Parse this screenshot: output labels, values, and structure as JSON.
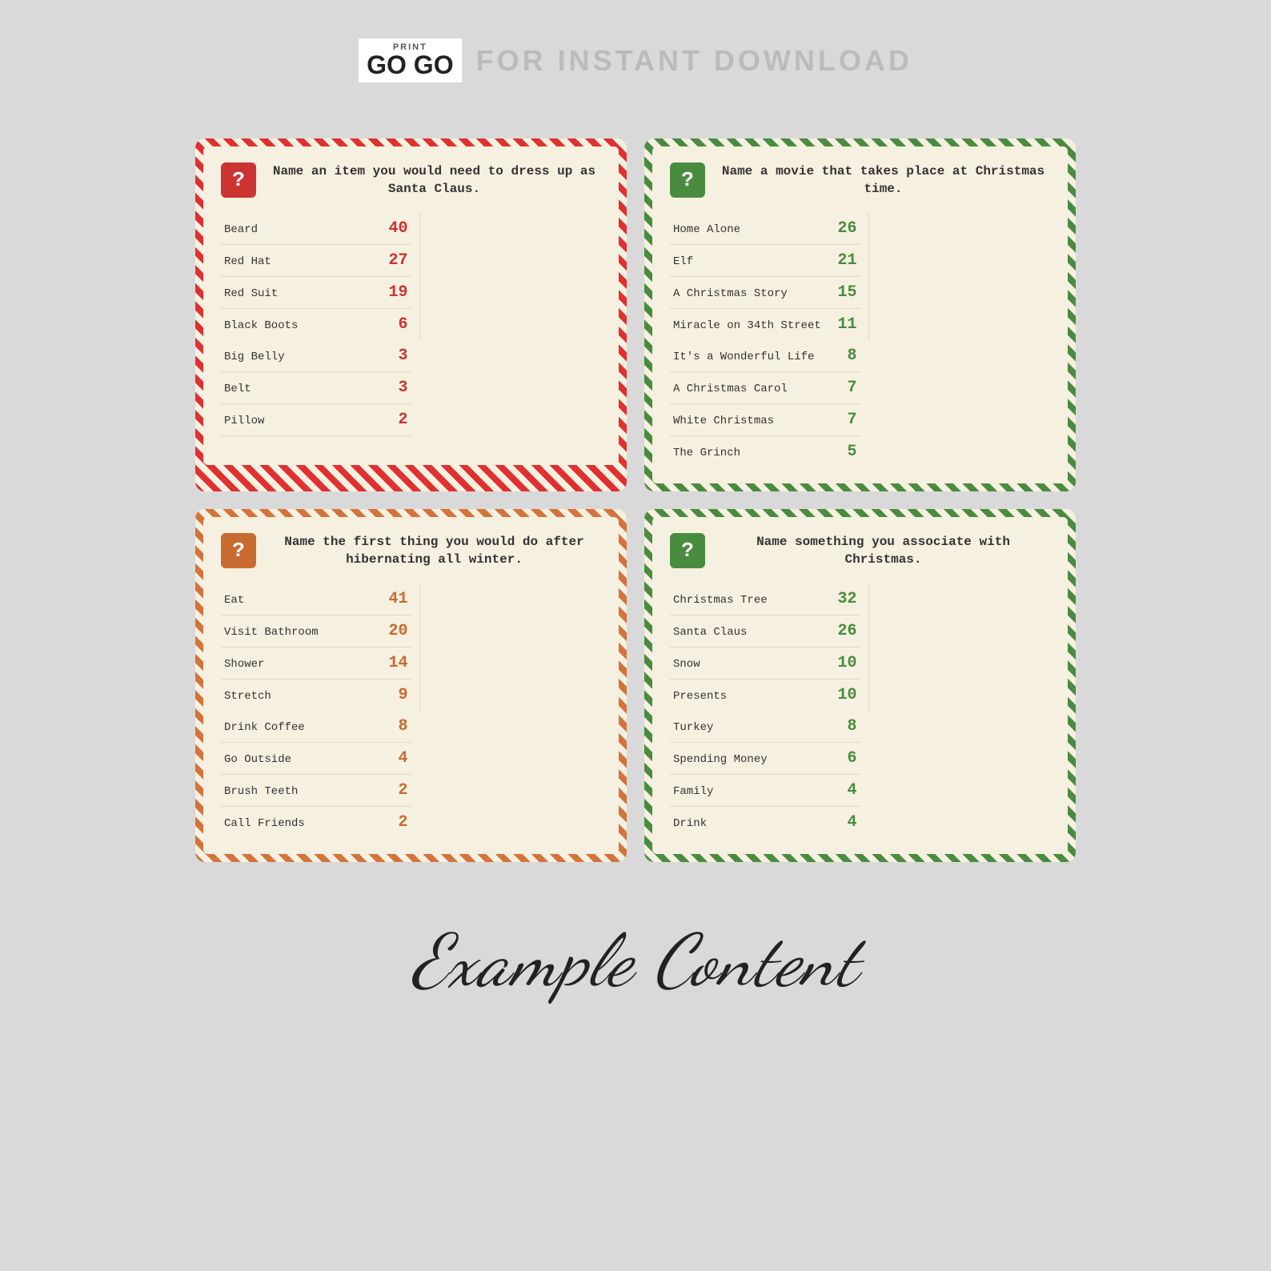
{
  "header": {
    "logo_print": "PRINT",
    "logo_gogo": "GO GO",
    "tagline": "FOR INSTANT DOWNLOAD"
  },
  "cards": [
    {
      "id": "card-santa",
      "border": "red",
      "icon_char": "?",
      "icon_color": "red",
      "title": "Name an item you would need to dress up as Santa Claus.",
      "left_items": [
        {
          "label": "Beard",
          "number": "40"
        },
        {
          "label": "Red Hat",
          "number": "27"
        },
        {
          "label": "Red Suit",
          "number": "19"
        },
        {
          "label": "Black Boots",
          "number": "6"
        }
      ],
      "right_items": [
        {
          "label": "Big Belly",
          "number": "3"
        },
        {
          "label": "Belt",
          "number": "3"
        },
        {
          "label": "Pillow",
          "number": "2"
        },
        {
          "label": "",
          "number": ""
        }
      ]
    },
    {
      "id": "card-movie",
      "border": "green",
      "icon_char": "?",
      "icon_color": "green",
      "title": "Name a movie that takes place at Christmas time.",
      "left_items": [
        {
          "label": "Home Alone",
          "number": "26"
        },
        {
          "label": "Elf",
          "number": "21"
        },
        {
          "label": "A Christmas Story",
          "number": "15"
        },
        {
          "label": "Miracle on 34th Street",
          "number": "11"
        }
      ],
      "right_items": [
        {
          "label": "It's a Wonderful Life",
          "number": "8"
        },
        {
          "label": "A Christmas Carol",
          "number": "7"
        },
        {
          "label": "White Christmas",
          "number": "7"
        },
        {
          "label": "The Grinch",
          "number": "5"
        }
      ]
    },
    {
      "id": "card-hibernate",
      "border": "orange",
      "icon_char": "?",
      "icon_color": "orange",
      "title": "Name the first thing you would do after hibernating all winter.",
      "left_items": [
        {
          "label": "Eat",
          "number": "41"
        },
        {
          "label": "Visit Bathroom",
          "number": "20"
        },
        {
          "label": "Shower",
          "number": "14"
        },
        {
          "label": "Stretch",
          "number": "9"
        }
      ],
      "right_items": [
        {
          "label": "Drink Coffee",
          "number": "8"
        },
        {
          "label": "Go Outside",
          "number": "4"
        },
        {
          "label": "Brush Teeth",
          "number": "2"
        },
        {
          "label": "Call Friends",
          "number": "2"
        }
      ]
    },
    {
      "id": "card-christmas",
      "border": "green",
      "icon_char": "?",
      "icon_color": "green",
      "title": "Name something you associate with Christmas.",
      "left_items": [
        {
          "label": "Christmas Tree",
          "number": "32"
        },
        {
          "label": "Santa Claus",
          "number": "26"
        },
        {
          "label": "Snow",
          "number": "10"
        },
        {
          "label": "Presents",
          "number": "10"
        }
      ],
      "right_items": [
        {
          "label": "Turkey",
          "number": "8"
        },
        {
          "label": "Spending Money",
          "number": "6"
        },
        {
          "label": "Family",
          "number": "4"
        },
        {
          "label": "Drink",
          "number": "4"
        }
      ]
    }
  ],
  "footer": {
    "text": "Example Content"
  }
}
